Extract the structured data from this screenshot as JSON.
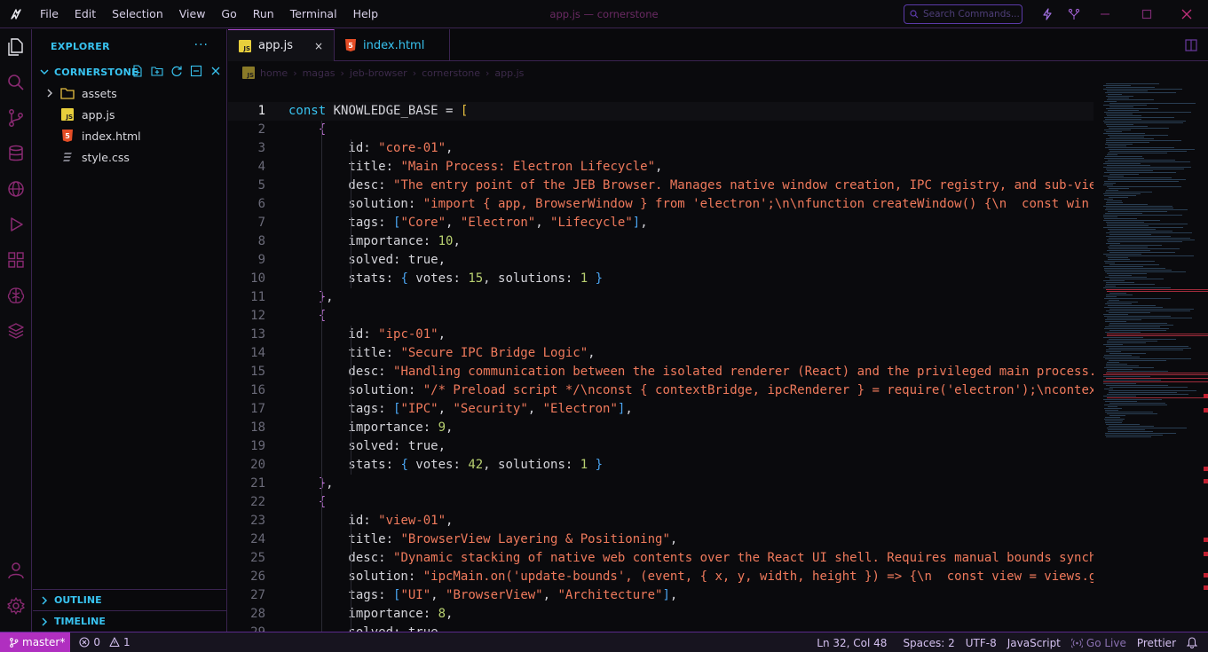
{
  "window": {
    "title": "app.js — cornerstone"
  },
  "menu": [
    "File",
    "Edit",
    "Selection",
    "View",
    "Go",
    "Run",
    "Terminal",
    "Help"
  ],
  "search": {
    "placeholder": "Search Commands..."
  },
  "sidebar": {
    "header": "EXPLORER",
    "more": "···",
    "project": "CORNERSTONE",
    "items": [
      {
        "name": "assets",
        "type": "folder"
      },
      {
        "name": "app.js",
        "type": "js"
      },
      {
        "name": "index.html",
        "type": "html"
      },
      {
        "name": "style.css",
        "type": "css"
      }
    ],
    "outline": "OUTLINE",
    "timeline": "TIMELINE"
  },
  "tabs": [
    {
      "label": "app.js",
      "close": "×",
      "active": true
    },
    {
      "label": "index.html",
      "active": false
    }
  ],
  "breadcrumb": [
    "home",
    "magas",
    "jeb-browser",
    "cornerstone",
    "app.js"
  ],
  "code": {
    "lines": [
      "const KNOWLEDGE_BASE = [",
      "    {",
      "        id: \"core-01\",",
      "        title: \"Main Process: Electron Lifecycle\",",
      "        desc: \"The entry point of the JEB Browser. Manages native window creation, IPC registry, and sub-vie",
      "        solution: \"import { app, BrowserWindow } from 'electron';\\n\\nfunction createWindow() {\\n  const win",
      "        tags: [\"Core\", \"Electron\", \"Lifecycle\"],",
      "        importance: 10,",
      "        solved: true,",
      "        stats: { votes: 15, solutions: 1 }",
      "    },",
      "    {",
      "        id: \"ipc-01\",",
      "        title: \"Secure IPC Bridge Logic\",",
      "        desc: \"Handling communication between the isolated renderer (React) and the privileged main process.",
      "        solution: \"/* Preload script */\\nconst { contextBridge, ipcRenderer } = require('electron');\\ncontex",
      "        tags: [\"IPC\", \"Security\", \"Electron\"],",
      "        importance: 9,",
      "        solved: true,",
      "        stats: { votes: 42, solutions: 1 }",
      "    },",
      "    {",
      "        id: \"view-01\",",
      "        title: \"BrowserView Layering & Positioning\",",
      "        desc: \"Dynamic stacking of native web contents over the React UI shell. Requires manual bounds synch",
      "        solution: \"ipcMain.on('update-bounds', (event, { x, y, width, height }) => {\\n  const view = views.g",
      "        tags: [\"UI\", \"BrowserView\", \"Architecture\"],",
      "        importance: 8,",
      "        solved: true,"
    ]
  },
  "status": {
    "branch": "master*",
    "errors": "0",
    "warnings": "1",
    "position": "Ln 32, Col 48",
    "spaces": "Spaces: 2",
    "encoding": "UTF-8",
    "language": "JavaScript",
    "golive": "Go Live",
    "formatter": "Prettier"
  },
  "colors": {
    "accent": "#b02fc0",
    "keyword": "#38c3f0",
    "string": "#f07a5c",
    "number": "#b8d070"
  }
}
